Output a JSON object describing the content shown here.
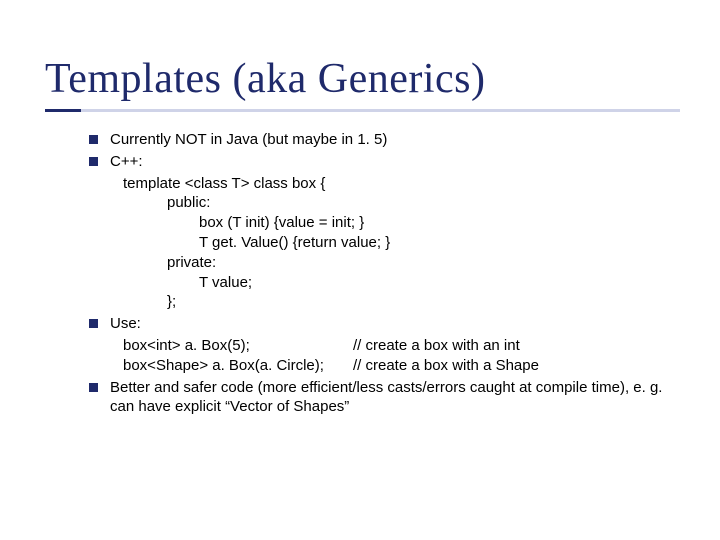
{
  "title": "Templates (aka Generics)",
  "bullets": {
    "b1": "Currently NOT in Java (but maybe in 1. 5)",
    "b2": "C++:",
    "code": {
      "l1": "template <class T> class box {",
      "l2": "public:",
      "l3": "box (T init) {value = init; }",
      "l4": "T get. Value() {return value; }",
      "l5": "private:",
      "l6": "T value;",
      "l7": "};"
    },
    "b3": "Use:",
    "use": {
      "r1c1": "box<int> a. Box(5);",
      "r1c2": "// create a box with an int",
      "r2c1": "box<Shape> a. Box(a. Circle);",
      "r2c2": "// create a box with a Shape"
    },
    "b4": "Better and safer code (more efficient/less casts/errors caught at compile time), e. g. can have explicit “Vector of Shapes”"
  }
}
